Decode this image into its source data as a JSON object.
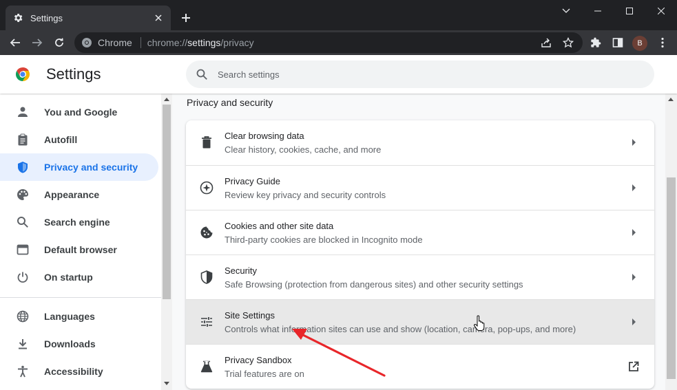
{
  "browser": {
    "tab_title": "Settings",
    "tab_icon": "gear-icon",
    "omnibox": {
      "site_label": "Chrome",
      "url_prefix": "chrome://",
      "url_host": "settings",
      "url_path": "/privacy"
    },
    "profile_initial": "B",
    "colors": {
      "frame": "#202124",
      "toolbar": "#35363a",
      "avatar": "#6b3f35"
    }
  },
  "header": {
    "title": "Settings",
    "search_placeholder": "Search settings"
  },
  "sidebar": {
    "items": [
      {
        "label": "You and Google",
        "icon": "person-icon",
        "active": false
      },
      {
        "label": "Autofill",
        "icon": "clipboard-icon",
        "active": false
      },
      {
        "label": "Privacy and security",
        "icon": "shield-icon",
        "active": true
      },
      {
        "label": "Appearance",
        "icon": "palette-icon",
        "active": false
      },
      {
        "label": "Search engine",
        "icon": "search-icon",
        "active": false
      },
      {
        "label": "Default browser",
        "icon": "browser-window-icon",
        "active": false
      },
      {
        "label": "On startup",
        "icon": "power-icon",
        "active": false
      },
      {
        "label": "Languages",
        "icon": "globe-icon",
        "active": false
      },
      {
        "label": "Downloads",
        "icon": "download-icon",
        "active": false
      },
      {
        "label": "Accessibility",
        "icon": "accessibility-icon",
        "active": false
      }
    ]
  },
  "main": {
    "section_title": "Privacy and security",
    "rows": [
      {
        "title": "Clear browsing data",
        "subtitle": "Clear history, cookies, cache, and more",
        "icon": "trash-icon",
        "action": "chevron-right-icon"
      },
      {
        "title": "Privacy Guide",
        "subtitle": "Review key privacy and security controls",
        "icon": "compass-icon",
        "action": "chevron-right-icon"
      },
      {
        "title": "Cookies and other site data",
        "subtitle": "Third-party cookies are blocked in Incognito mode",
        "icon": "cookie-icon",
        "action": "chevron-right-icon"
      },
      {
        "title": "Security",
        "subtitle": "Safe Browsing (protection from dangerous sites) and other security settings",
        "icon": "shield-outline-icon",
        "action": "chevron-right-icon"
      },
      {
        "title": "Site Settings",
        "subtitle": "Controls what information sites can use and show (location, camera, pop-ups, and more)",
        "icon": "sliders-icon",
        "action": "chevron-right-icon",
        "hovered": true
      },
      {
        "title": "Privacy Sandbox",
        "subtitle": "Trial features are on",
        "icon": "flask-icon",
        "action": "external-link-icon"
      }
    ]
  },
  "colors": {
    "accent": "#1a73e8",
    "active_bg": "#e8f0fe",
    "annotation_arrow": "#e8262a"
  }
}
